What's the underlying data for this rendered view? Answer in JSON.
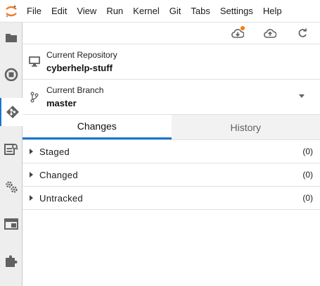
{
  "menubar": {
    "items": [
      "File",
      "Edit",
      "View",
      "Run",
      "Kernel",
      "Git",
      "Tabs",
      "Settings",
      "Help"
    ]
  },
  "colors": {
    "accent": "#1976d2",
    "badge": "#f57c00",
    "jupyter_orange": "#f37726"
  },
  "leftbar": {
    "icons": [
      "folder-icon",
      "running-icon",
      "git-icon",
      "property-inspector-icon",
      "extension-settings-icon",
      "tabs-icon",
      "extension-manager-icon"
    ]
  },
  "toolbar": {
    "icons": [
      "cloud-download-icon",
      "cloud-upload-icon",
      "refresh-icon"
    ]
  },
  "repository": {
    "label": "Current Repository",
    "value": "cyberhelp-stuff"
  },
  "branch": {
    "label": "Current Branch",
    "value": "master"
  },
  "tabs": {
    "changes": "Changes",
    "history": "History"
  },
  "sections": [
    {
      "title": "Staged",
      "count": "(0)"
    },
    {
      "title": "Changed",
      "count": "(0)"
    },
    {
      "title": "Untracked",
      "count": "(0)"
    }
  ]
}
